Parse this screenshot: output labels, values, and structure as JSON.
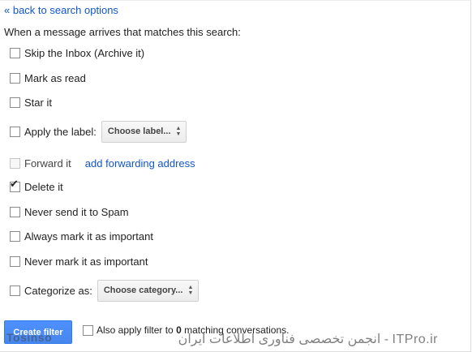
{
  "back_link": "« back to search options",
  "heading": "When a message arrives that matches this search:",
  "options": {
    "skip_inbox": {
      "label": "Skip the Inbox (Archive it)",
      "checked": false
    },
    "mark_read": {
      "label": "Mark as read",
      "checked": false
    },
    "star": {
      "label": "Star it",
      "checked": false
    },
    "apply_label": {
      "label": "Apply the label:",
      "checked": false,
      "select": "Choose label..."
    },
    "forward": {
      "label": "Forward it",
      "checked": false,
      "link": "add forwarding address"
    },
    "delete": {
      "label": "Delete it",
      "checked": true
    },
    "never_spam": {
      "label": "Never send it to Spam",
      "checked": false
    },
    "always_important": {
      "label": "Always mark it as important",
      "checked": false
    },
    "never_important": {
      "label": "Never mark it as important",
      "checked": false
    },
    "categorize": {
      "label": "Categorize as:",
      "checked": false,
      "select": "Choose category..."
    }
  },
  "footer": {
    "create_button": "Create filter",
    "also_apply_prefix": "Also apply filter to",
    "also_apply_count": "0",
    "also_apply_suffix": "matching conversations."
  },
  "watermark": {
    "left": "Tosinso",
    "right": "انجمن تخصصی فناوری اطلاعات ایران - ITPro.ir"
  },
  "colors": {
    "link": "#1155cc",
    "button": "#4d90fe"
  }
}
